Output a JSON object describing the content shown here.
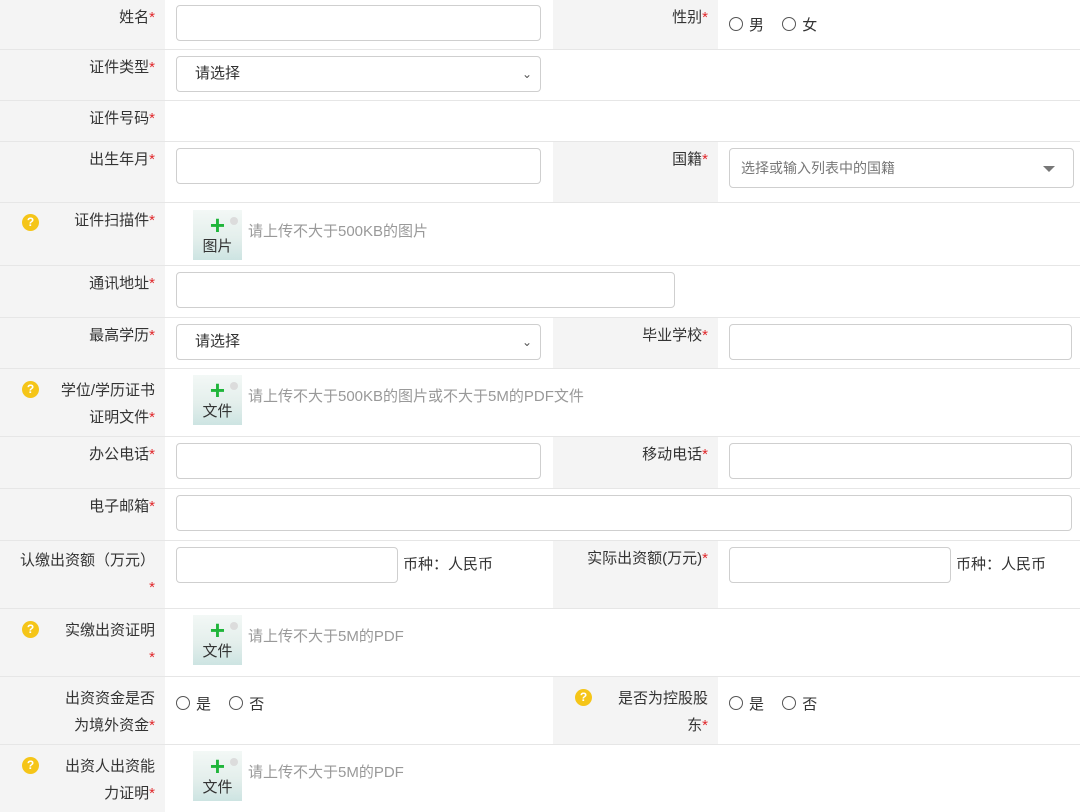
{
  "required_mark": "*",
  "help_glyph": "?",
  "colors": {
    "required": "#e0262a",
    "help_badge": "#f5c518",
    "upload_plus": "#1fb53a",
    "label_bg": "#f4f4f4",
    "hint": "#999999"
  },
  "icons": {
    "help": "question-circle-icon",
    "upload": "plus-icon",
    "select": "chevron-down-icon",
    "combo": "caret-down-icon"
  },
  "name": {
    "label": "姓名",
    "value": ""
  },
  "gender": {
    "label": "性别",
    "options": [
      "男",
      "女"
    ]
  },
  "id_type": {
    "label": "证件类型",
    "selected": "请选择"
  },
  "id_number": {
    "label": "证件号码"
  },
  "birth": {
    "label": "出生年月",
    "value": ""
  },
  "nationality": {
    "label": "国籍",
    "placeholder": "选择或输入列表中的国籍"
  },
  "id_scan": {
    "label": "证件扫描件",
    "button": "图片",
    "hint": "请上传不大于500KB的图片"
  },
  "address": {
    "label": "通讯地址",
    "value": ""
  },
  "education": {
    "label": "最高学历",
    "selected": "请选择"
  },
  "school": {
    "label": "毕业学校",
    "value": ""
  },
  "degree_cert": {
    "label_line1": "学位/学历证书",
    "label_line2": "证明文件",
    "button": "文件",
    "hint": "请上传不大于500KB的图片或不大于5M的PDF文件"
  },
  "office_phone": {
    "label": "办公电话",
    "value": ""
  },
  "mobile": {
    "label": "移动电话",
    "value": ""
  },
  "email": {
    "label": "电子邮箱",
    "value": ""
  },
  "subscribed_capital": {
    "label": "认缴出资额（万元）",
    "currency": "币种：人民币"
  },
  "actual_capital": {
    "label": "实际出资额(万元)",
    "currency": "币种：人民币"
  },
  "paid_proof": {
    "label": "实缴出资证明",
    "button": "文件",
    "hint": "请上传不大于5M的PDF"
  },
  "overseas_funds": {
    "label_line1": "出资资金是否",
    "label_line2": "为境外资金",
    "options": [
      "是",
      "否"
    ]
  },
  "controlling": {
    "label_line1": "是否为控股股",
    "label_line2": "东",
    "options": [
      "是",
      "否"
    ]
  },
  "ability_proof": {
    "label_line1": "出资人出资能",
    "label_line2": "力证明",
    "button": "文件",
    "hint": "请上传不大于5M的PDF"
  }
}
